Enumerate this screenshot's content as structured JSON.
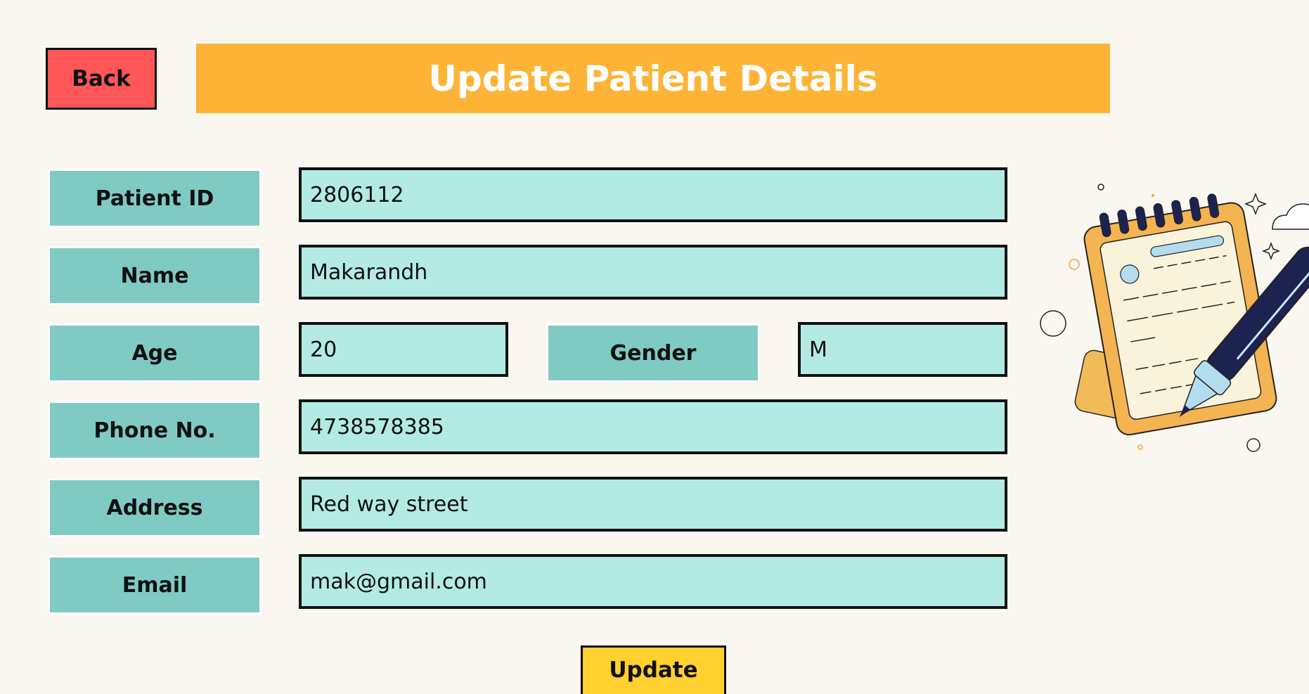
{
  "header": {
    "back_label": "Back",
    "title": "Update Patient Details"
  },
  "form": {
    "patient_id": {
      "label": "Patient ID",
      "value": "2806112"
    },
    "name": {
      "label": "Name",
      "value": "Makarandh"
    },
    "age": {
      "label": "Age",
      "value": "20"
    },
    "gender": {
      "label": "Gender",
      "value": "M"
    },
    "phone": {
      "label": "Phone No.",
      "value": "4738578385"
    },
    "address": {
      "label": "Address",
      "value": "Red way street"
    },
    "email": {
      "label": "Email",
      "value": "mak@gmail.com"
    }
  },
  "actions": {
    "update_label": "Update"
  },
  "illustration": {
    "icon": "notepad-pen-icon"
  },
  "colors": {
    "background": "#faf7f0",
    "title_bar": "#fdb436",
    "back_button": "#ff5757",
    "update_button": "#ffd02e",
    "label_fill": "#80cac4",
    "field_fill": "#b3ebe4"
  }
}
